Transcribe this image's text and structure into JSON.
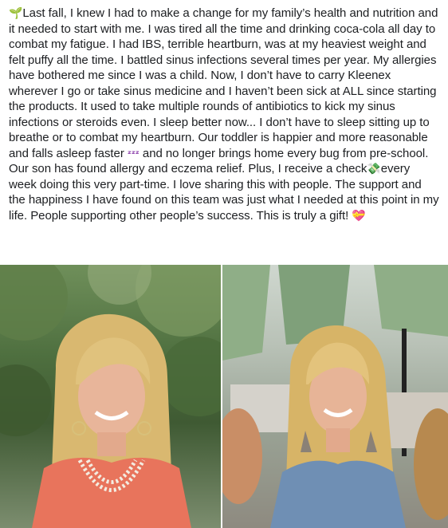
{
  "post": {
    "segments": [
      {
        "type": "emoji",
        "icon": "seedling-icon",
        "glyph": "🌱"
      },
      {
        "type": "text",
        "text": "Last fall, I knew I had to make a change for my family’s health and nutrition and it needed to start with me. I was tired all the time and drinking coca-cola all day to combat my fatigue. I had IBS, terrible heartburn, was at my heaviest weight and felt puffy all the time. I battled sinus infections several times per year. My allergies have bothered me since I was a child. Now, I don’t have to carry Kleenex wherever I go or take sinus medicine and I haven’t been sick at ALL since starting the products. It used to take multiple rounds of antibiotics to kick my sinus infections or steroids even. I sleep better now... I don’t have to sleep sitting up to breathe or to combat my heartburn. Our toddler is happier and more reasonable and falls asleep faster "
      },
      {
        "type": "emoji",
        "icon": "zzz-icon",
        "glyph": "ᶻᶻᶻ"
      },
      {
        "type": "text",
        "text": " and no longer brings home every bug from pre-school. Our son has found allergy and eczema relief. Plus, I receive a check"
      },
      {
        "type": "emoji",
        "icon": "money-with-wings-icon",
        "glyph": "💸"
      },
      {
        "type": "text",
        "text": "every week doing this very part-time. I love sharing this with people. The support and the happiness I have found on this team was just what I needed at this point in my life. People supporting other people’s success. This is truly a gift! "
      },
      {
        "type": "emoji",
        "icon": "heart-gift-icon",
        "glyph": "💝"
      }
    ]
  },
  "photos": {
    "left": {
      "description_icon": "before-photo"
    },
    "right": {
      "description_icon": "after-photo"
    }
  }
}
